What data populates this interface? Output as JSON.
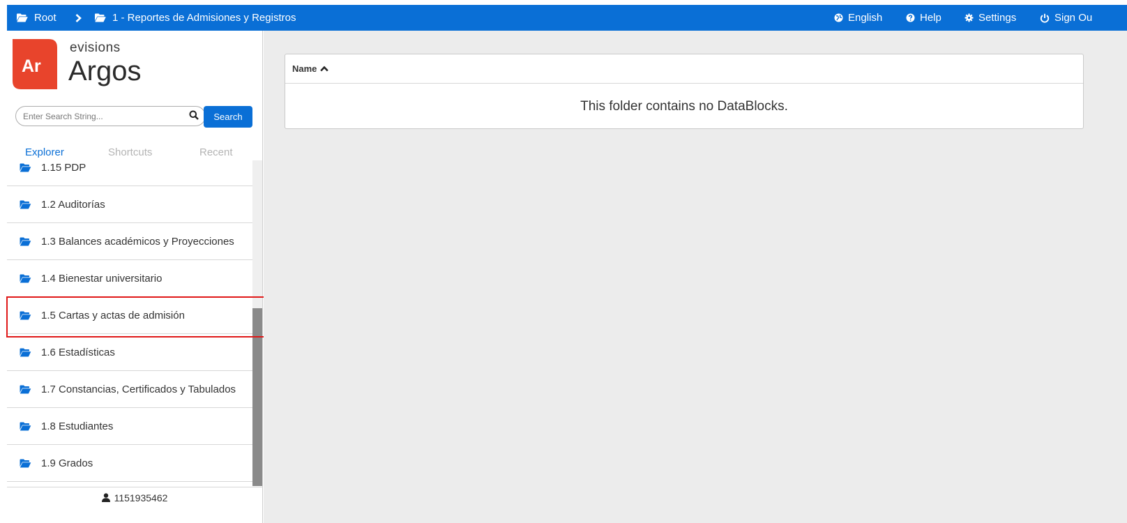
{
  "breadcrumb": {
    "root": "Root",
    "current": "1 - Reportes de Admisiones y Registros"
  },
  "nav": {
    "language": "English",
    "help": "Help",
    "settings": "Settings",
    "sign_out": "Sign Ou"
  },
  "brand": {
    "logo_letters": "Ar",
    "company": "evisions",
    "product": "Argos",
    "logo_color": "#e8442c"
  },
  "search": {
    "placeholder": "Enter Search String...",
    "button_label": "Search"
  },
  "tabs": [
    {
      "label": "Explorer",
      "active": true
    },
    {
      "label": "Shortcuts",
      "active": false
    },
    {
      "label": "Recent",
      "active": false
    }
  ],
  "folders": [
    {
      "label": "1.15 PDP"
    },
    {
      "label": "1.2 Auditorías"
    },
    {
      "label": "1.3 Balances académicos y Proyecciones"
    },
    {
      "label": "1.4 Bienestar universitario"
    },
    {
      "label": "1.5 Cartas y actas de admisión",
      "highlighted": true
    },
    {
      "label": "1.6 Estadísticas"
    },
    {
      "label": "1.7 Constancias, Certificados y Tabulados"
    },
    {
      "label": "1.8 Estudiantes"
    },
    {
      "label": "1.9 Grados"
    }
  ],
  "user": {
    "id": "1151935462"
  },
  "table": {
    "column_name": "Name",
    "sort": "ascending",
    "empty_message": "This folder contains no DataBlocks."
  },
  "colors": {
    "accent": "#0a6fd6",
    "highlight_border": "#e01818",
    "main_bg": "#ececec"
  }
}
